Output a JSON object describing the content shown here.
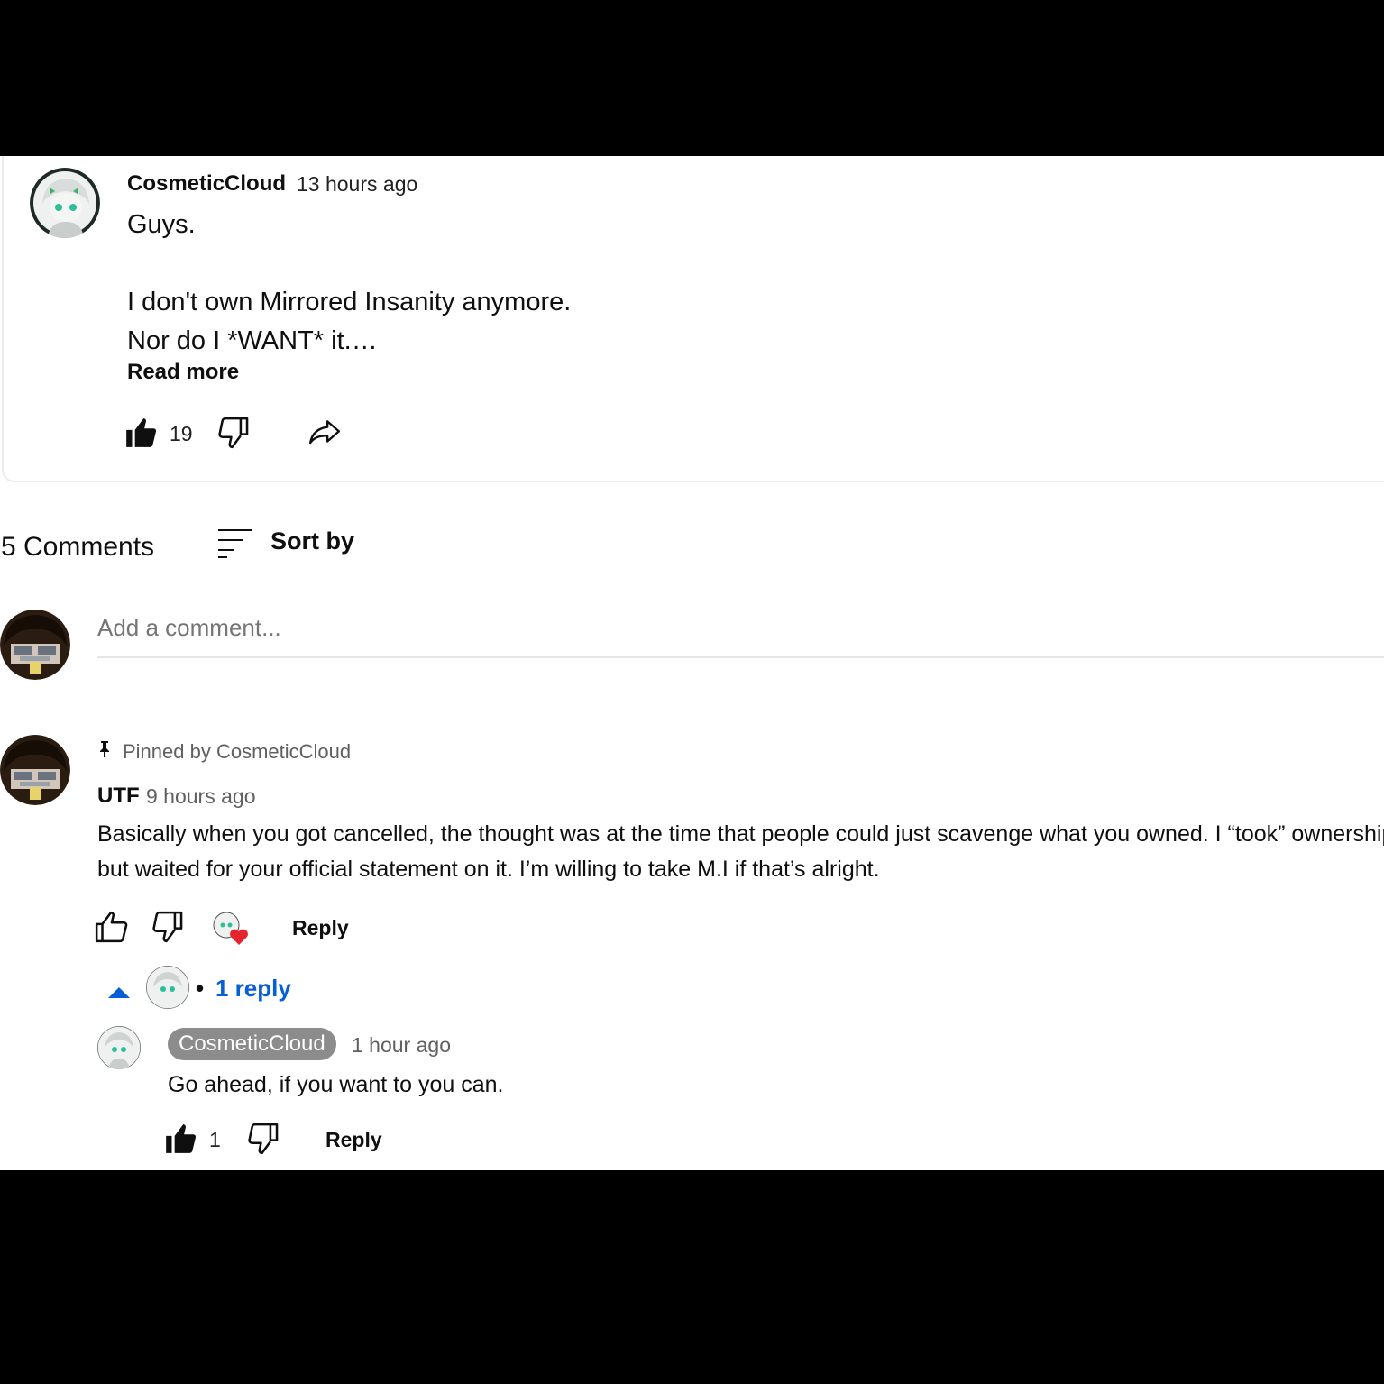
{
  "post": {
    "author": "CosmeticCloud",
    "time": "13 hours ago",
    "body": "Guys.\n\nI don't own Mirrored Insanity anymore.\nNor do I *WANT* it.…",
    "read_more": "Read more",
    "likes": "19"
  },
  "comments_header": {
    "count_label": "5 Comments",
    "sort_label": "Sort by"
  },
  "add_comment": {
    "placeholder": "Add a comment..."
  },
  "pinned_comment": {
    "pinned_label": "Pinned by CosmeticCloud",
    "author": "UTF",
    "time": "9 hours ago",
    "body": "Basically when you got cancelled, the thought was at the time that people could just scavenge what you owned. I “took” ownership but waited for your official statement on it. I’m willing to take M.I if that’s alright.",
    "reply_label": "Reply",
    "replies_toggle": "1 reply",
    "bullet": "•"
  },
  "reply": {
    "author": "CosmeticCloud",
    "time": "1 hour ago",
    "body": "Go ahead, if you want to you can.",
    "likes": "1",
    "reply_label": "Reply"
  },
  "icons": {
    "like": "thumbs-up-icon",
    "dislike": "thumbs-down-icon",
    "share": "share-icon",
    "sort": "sort-icon",
    "pin": "pin-icon",
    "heart": "creator-heart-icon",
    "collapse": "caret-up-icon"
  },
  "colors": {
    "link_blue": "#065fd4",
    "heart_red": "#e4242e",
    "chip_grey": "#8c8c8c",
    "text": "#0f0f0f",
    "meta": "#606060"
  }
}
